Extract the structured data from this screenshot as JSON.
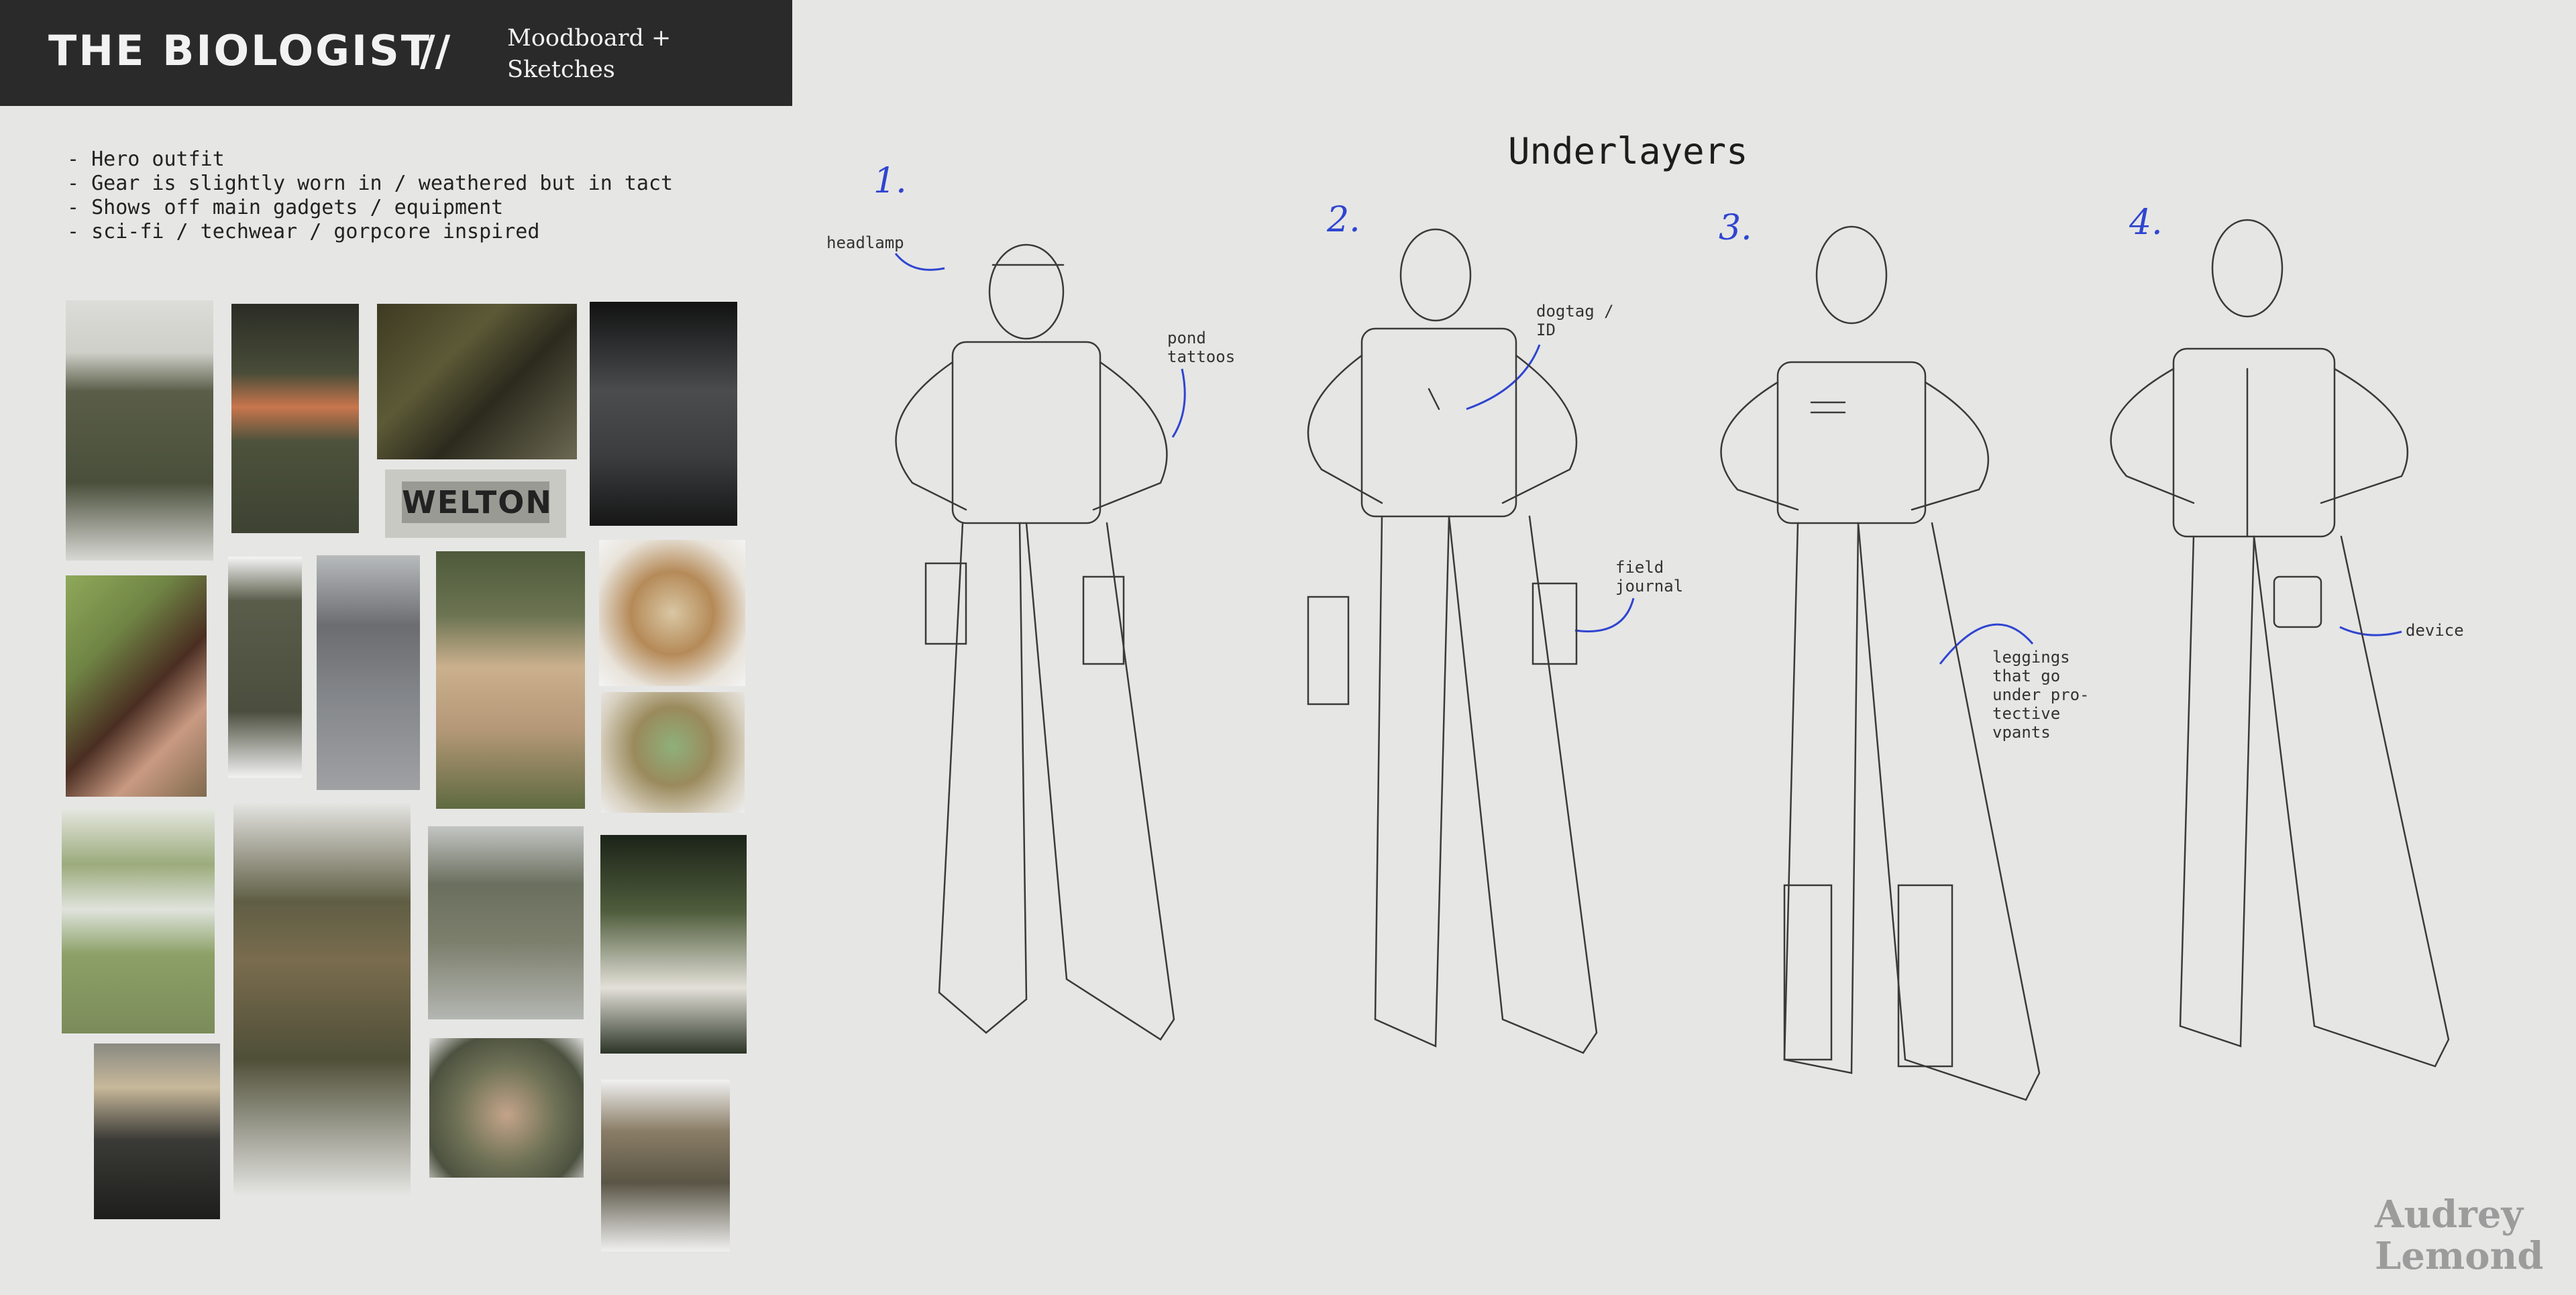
{
  "header": {
    "title": "THE BIOLOGIST",
    "separator": "//",
    "subtitle": "Moodboard +\nSketches"
  },
  "notes": [
    "- Hero outfit",
    "- Gear is slightly worn in / weathered but in tact",
    "- Shows off main gadgets / equipment",
    "- sci-fi / techwear / gorpcore inspired"
  ],
  "moodboard": {
    "patch_text": "WELTON"
  },
  "sheet": {
    "title": "Underlayers",
    "figures": [
      {
        "number": "1."
      },
      {
        "number": "2."
      },
      {
        "number": "3."
      },
      {
        "number": "4."
      }
    ],
    "annotations": {
      "headlamp": "headlamp",
      "pond_tattoos": "pond\ntattoos",
      "dogtag": "dogtag /\nID",
      "field_journal": "field\njournal",
      "leggings": "leggings\nthat go\nunder pro-\ntective\nvpants",
      "device": "device"
    }
  },
  "signature": {
    "line1": "Audrey",
    "line2": "Lemond"
  },
  "colors": {
    "background": "#e6e6e5",
    "header_bg": "#2a2a2a",
    "annotation_blue": "#2f45d0"
  }
}
